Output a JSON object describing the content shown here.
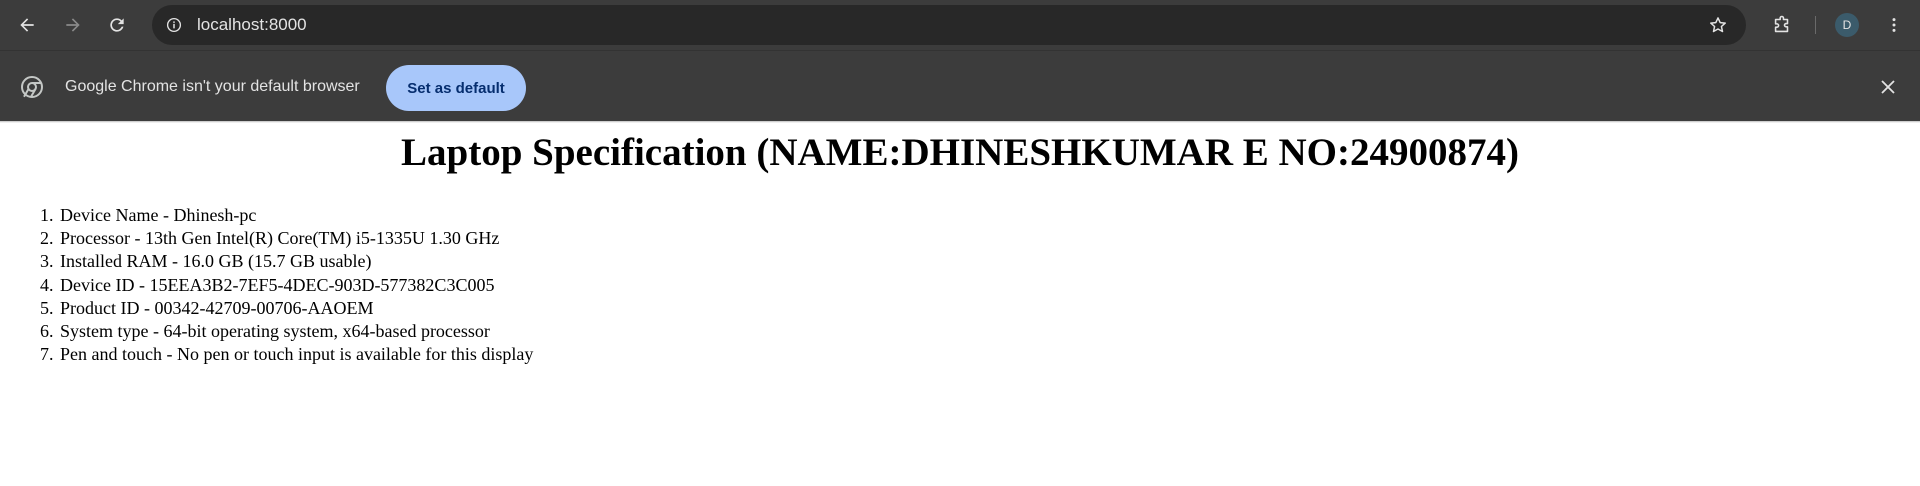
{
  "browser": {
    "url": "localhost:8000",
    "profile_initial": "D",
    "icons": {
      "back": "back-arrow-icon",
      "forward": "forward-arrow-icon",
      "reload": "reload-icon",
      "site_info": "info-icon",
      "bookmark": "star-icon",
      "extensions": "puzzle-icon",
      "menu": "kebab-menu-icon"
    }
  },
  "infobar": {
    "message": "Google Chrome isn't your default browser",
    "button_label": "Set as default",
    "icons": {
      "chrome": "chrome-logo-icon",
      "close": "close-icon"
    }
  },
  "page": {
    "title": "Laptop Specification (NAME:DHINESHKUMAR E NO:24900874)",
    "specs": [
      {
        "num": "1.",
        "text": "Device Name - Dhinesh-pc"
      },
      {
        "num": "2.",
        "text": "Processor - 13th Gen Intel(R) Core(TM) i5-1335U 1.30 GHz"
      },
      {
        "num": "3.",
        "text": "Installed RAM - 16.0 GB (15.7 GB usable)"
      },
      {
        "num": "4.",
        "text": "Device ID - 15EEA3B2-7EF5-4DEC-903D-577382C3C005"
      },
      {
        "num": "5.",
        "text": "Product ID - 00342-42709-00706-AAOEM"
      },
      {
        "num": "6.",
        "text": "System type - 64-bit operating system, x64-based processor"
      },
      {
        "num": "7.",
        "text": "Pen and touch - No pen or touch input is available for this display"
      }
    ]
  },
  "colors": {
    "toolbar_bg": "#3c3c3c",
    "omnibox_bg": "#282828",
    "button_bg": "#a8c7fa",
    "button_text": "#062e6f"
  }
}
